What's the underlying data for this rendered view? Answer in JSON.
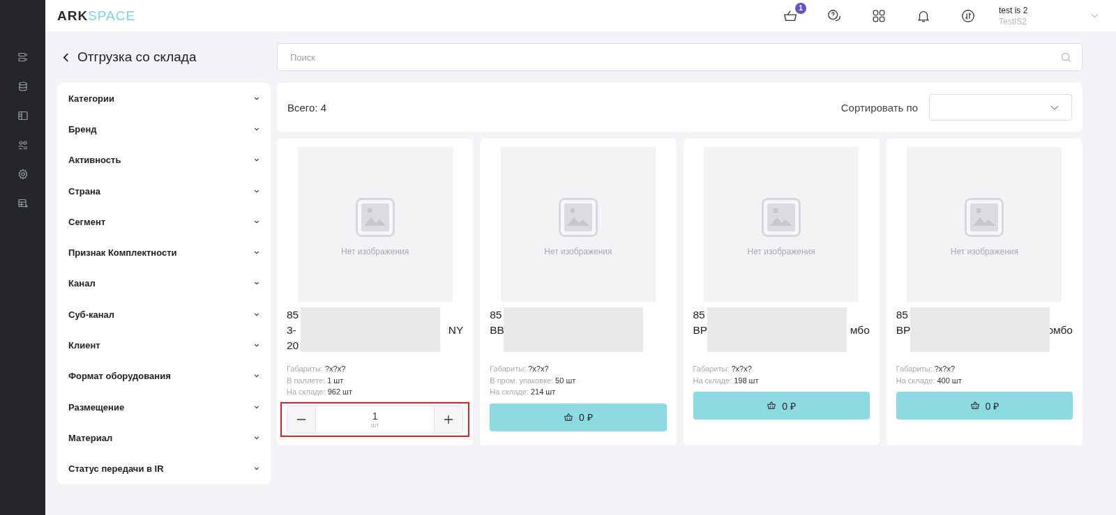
{
  "logo": {
    "bold": "ARK",
    "light": "SPACE"
  },
  "header": {
    "cart_badge": "1",
    "user": {
      "name": "test is 2",
      "org": "TestIS2"
    }
  },
  "nav_items": [
    {
      "kind": "servers"
    },
    {
      "kind": "database"
    },
    {
      "kind": "layout"
    },
    {
      "kind": "users"
    },
    {
      "kind": "settings"
    },
    {
      "kind": "table-add"
    }
  ],
  "page_title": "Отгрузка со склада",
  "search": {
    "placeholder": "Поиск"
  },
  "filters": [
    {
      "label": "Категории",
      "expanded": false
    },
    {
      "label": "Бренд",
      "expanded": false
    },
    {
      "label": "Активность",
      "expanded": false
    },
    {
      "label": "Страна",
      "expanded": false
    },
    {
      "label": "Сегмент",
      "expanded": false
    },
    {
      "label": "Признак Комплектности",
      "expanded": false
    },
    {
      "label": "Канал",
      "expanded": false
    },
    {
      "label": "Суб-канал",
      "expanded": false
    },
    {
      "label": "Клиент",
      "expanded": false
    },
    {
      "label": "Формат оборудования",
      "expanded": false
    },
    {
      "label": "Размещение",
      "expanded": false
    },
    {
      "label": "Материал",
      "expanded": false
    },
    {
      "label": "Статус передачи в IR",
      "expanded": false
    }
  ],
  "total": "Всего: 4",
  "sort": {
    "label": "Сортировать по"
  },
  "products": [
    {
      "no_image": "Нет изображения",
      "name_lines": [
        {
          "start": "85"
        },
        {
          "start": "3-",
          "end": "NY"
        },
        {
          "start": "20"
        }
      ],
      "details": [
        {
          "label": "Габариты:",
          "value": "?x?x?"
        },
        {
          "label": "В паллете:",
          "value": "1 шт"
        },
        {
          "label": "На складе:",
          "value": "962 шт"
        }
      ],
      "kind": "stepper",
      "quantity": "1",
      "unit": "шт",
      "highlighted": true
    },
    {
      "no_image": "Нет изображения",
      "name_lines": [
        {
          "start": "85"
        },
        {
          "start": "BB"
        }
      ],
      "details": [
        {
          "label": "Габариты:",
          "value": "?x?x?"
        },
        {
          "label": "В пром. упаковке:",
          "value": "50 шт"
        },
        {
          "label": "На складе:",
          "value": "214 шт"
        }
      ],
      "kind": "cart",
      "price": "0 ₽"
    },
    {
      "no_image": "Нет изображения",
      "name_lines": [
        {
          "start": "85"
        },
        {
          "start": "BP",
          "end": "мбо"
        }
      ],
      "details": [
        {
          "label": "Габариты:",
          "value": "?x?x?"
        },
        {
          "label": "На складе:",
          "value": "198 шт"
        }
      ],
      "kind": "cart",
      "price": "0 ₽"
    },
    {
      "no_image": "Нет изображения",
      "name_lines": [
        {
          "start": "85"
        },
        {
          "start": "BP",
          "end": "омбо"
        }
      ],
      "details": [
        {
          "label": "Габариты:",
          "value": "?x?x?"
        },
        {
          "label": "На складе:",
          "value": "400 шт"
        }
      ],
      "kind": "cart",
      "price": "0 ₽"
    }
  ]
}
